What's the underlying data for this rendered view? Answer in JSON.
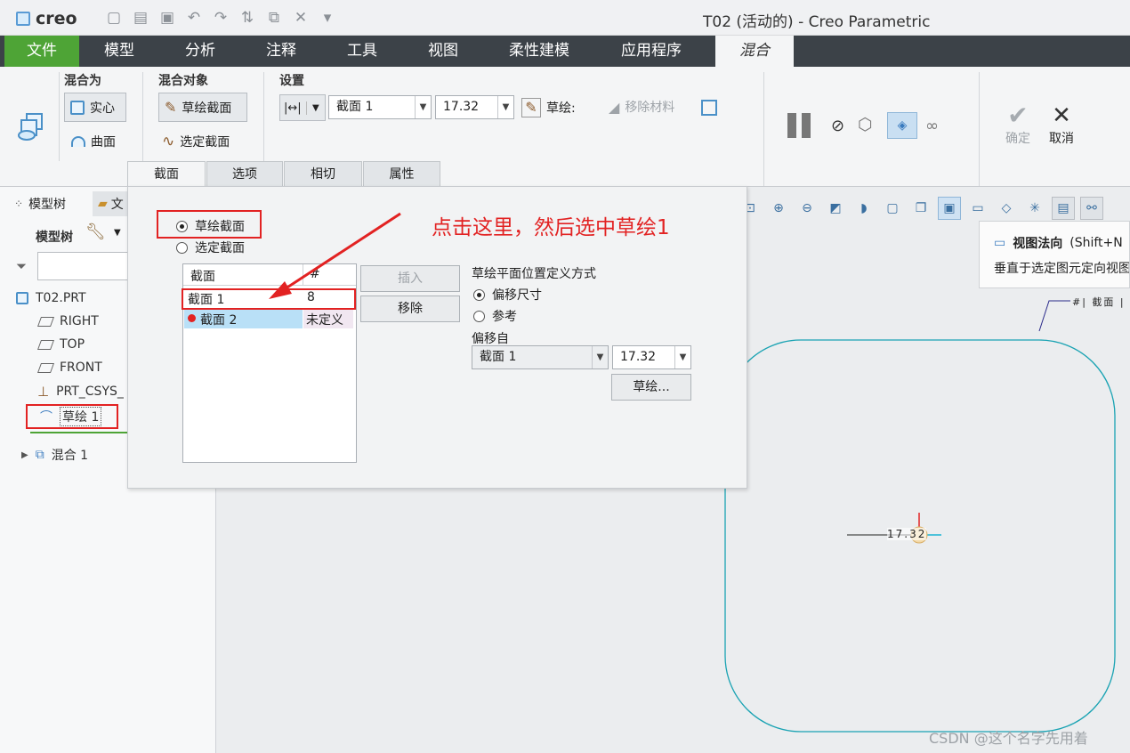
{
  "window": {
    "logo": "creo",
    "title": "T02 (活动的) - Creo Parametric",
    "qat_icons": [
      "new-icon",
      "open-icon",
      "save-icon",
      "undo-icon",
      "redo-icon",
      "regenerate-icon",
      "window-icon",
      "close-window-icon",
      "customize-icon"
    ]
  },
  "ribbon_tabs": {
    "file": "文件",
    "items": [
      "模型",
      "分析",
      "注释",
      "工具",
      "视图",
      "柔性建模",
      "应用程序"
    ],
    "active": "混合"
  },
  "ribbon": {
    "blend_as": {
      "title": "混合为",
      "solid": "实心",
      "surface": "曲面"
    },
    "blend_object": {
      "title": "混合对象",
      "sketch_section": "草绘截面",
      "select_section": "选定截面"
    },
    "settings": {
      "title": "设置",
      "section_value": "截面 1",
      "offset_value": "17.32",
      "sketch_label": "草绘:",
      "remove_material": "移除材料"
    },
    "confirm": "确定",
    "cancel": "取消",
    "subtabs": [
      "截面",
      "选项",
      "相切",
      "属性"
    ]
  },
  "left_panel": {
    "tab_model_tree": "模型树",
    "tab_other": "文",
    "header": "模型树",
    "items": {
      "part": "T02.PRT",
      "right": "RIGHT",
      "top": "TOP",
      "front": "FRONT",
      "csys": "PRT_CSYS_",
      "sketch": "草绘 1",
      "blend": "混合 1"
    }
  },
  "dialog": {
    "radio_sketch": "草绘截面",
    "radio_select": "选定截面",
    "table": {
      "headers": [
        "截面",
        "#"
      ],
      "rows": [
        {
          "name": "截面 1",
          "num": "8"
        },
        {
          "name": "截面 2",
          "num": "未定义"
        }
      ]
    },
    "insert": "插入",
    "remove": "移除",
    "plane_def_title": "草绘平面位置定义方式",
    "opt_offset": "偏移尺寸",
    "opt_ref": "参考",
    "offset_from": "偏移自",
    "offset_section": "截面 1",
    "offset_value": "17.32",
    "sketch_btn": "草绘..."
  },
  "annotation": "点击这里，然后选中草绘1",
  "tooltip": {
    "title": "视图法向",
    "shortcut": "(Shift+N",
    "desc": "垂直于选定图元定向视图"
  },
  "graphics": {
    "dim_label": "17.32",
    "section_tag": "截面"
  },
  "watermark": "CSDN @这个名字先用着",
  "colors": {
    "accent_green": "#4ea436",
    "annotation_red": "#e22222",
    "sketch_cyan": "#1aa3b3"
  }
}
